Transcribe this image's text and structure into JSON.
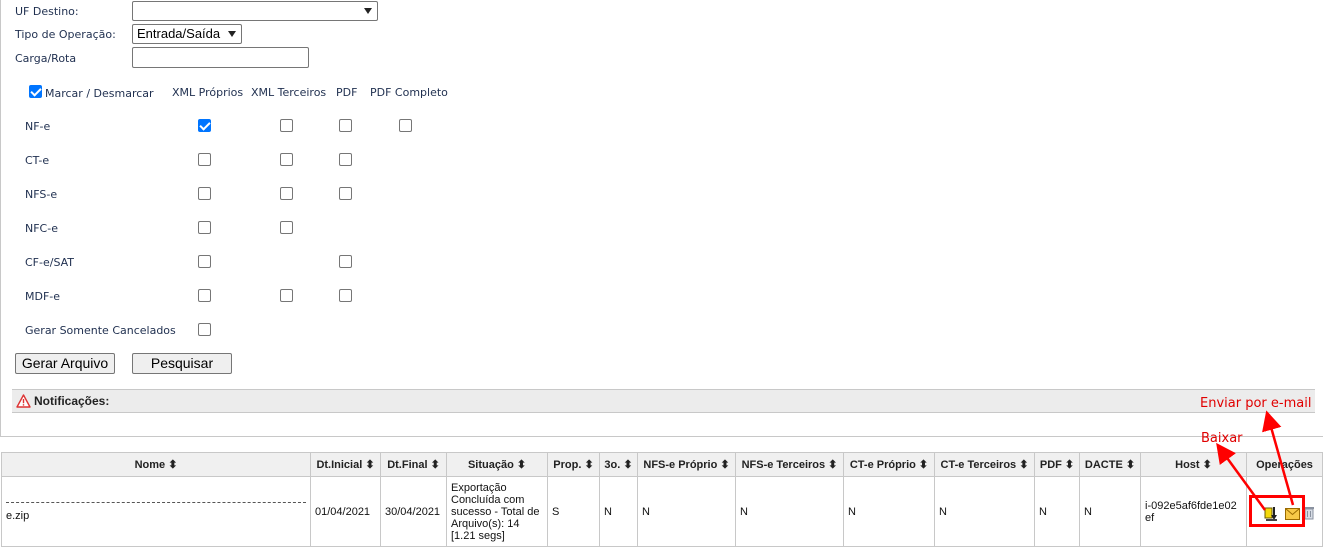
{
  "form": {
    "uf_destino_label": "UF Destino:",
    "uf_destino_value": "",
    "tipo_operacao_label": "Tipo de Operação:",
    "tipo_operacao_value": "Entrada/Saída",
    "carga_rota_label": "Carga/Rota",
    "carga_rota_value": ""
  },
  "selection": {
    "mark_all_label": "Marcar / Desmarcar",
    "mark_all_checked": true,
    "columns": [
      "XML Próprios",
      "XML Terceiros",
      "PDF",
      "PDF Completo"
    ],
    "rows": [
      {
        "label": "NF-e",
        "xml_proprios": true,
        "xml_terceiros": false,
        "pdf": false,
        "pdf_completo": false
      },
      {
        "label": "CT-e",
        "xml_proprios": false,
        "xml_terceiros": false,
        "pdf": false
      },
      {
        "label": "NFS-e",
        "xml_proprios": false,
        "xml_terceiros": false,
        "pdf": false
      },
      {
        "label": "NFC-e",
        "xml_proprios": false,
        "xml_terceiros": false
      },
      {
        "label": "CF-e/SAT",
        "xml_proprios": false,
        "pdf": false
      },
      {
        "label": "MDF-e",
        "xml_proprios": false,
        "xml_terceiros": false,
        "pdf": false
      }
    ],
    "only_cancelled_label": "Gerar Somente Cancelados",
    "only_cancelled_checked": false
  },
  "buttons": {
    "generate": "Gerar Arquivo",
    "search": "Pesquisar"
  },
  "notifications": {
    "title": "Notificações:",
    "icon": "warning-icon"
  },
  "table": {
    "headers": [
      "Nome ⬍",
      "Dt.Inicial ⬍",
      "Dt.Final ⬍",
      "Situação ⬍",
      "Prop. ⬍",
      "3o. ⬍",
      "NFS-e Próprio ⬍",
      "NFS-e Terceiros ⬍",
      "CT-e Próprio ⬍",
      "CT-e Terceiros ⬍",
      "PDF ⬍",
      "DACTE ⬍",
      "Host ⬍",
      "Operações"
    ],
    "rows": [
      {
        "nome": "e.zip",
        "dt_inicial": "01/04/2021",
        "dt_final": "30/04/2021",
        "situacao": "Exportação Concluída com sucesso - Total de Arquivo(s): 14 [1.21 segs]",
        "prop": "S",
        "terceiros": "N",
        "nfse_proprio": "N",
        "nfse_terceiros": "N",
        "cte_proprio": "N",
        "cte_terceiros": "N",
        "pdf": "N",
        "dacte": "N",
        "host": "i-092e5af6fde1e02ef",
        "operations": [
          "download-icon",
          "email-icon",
          "trash-icon"
        ]
      }
    ]
  },
  "annotations": {
    "email": "Enviar por e-mail",
    "download": "Baixar",
    "color": "#e00000"
  }
}
